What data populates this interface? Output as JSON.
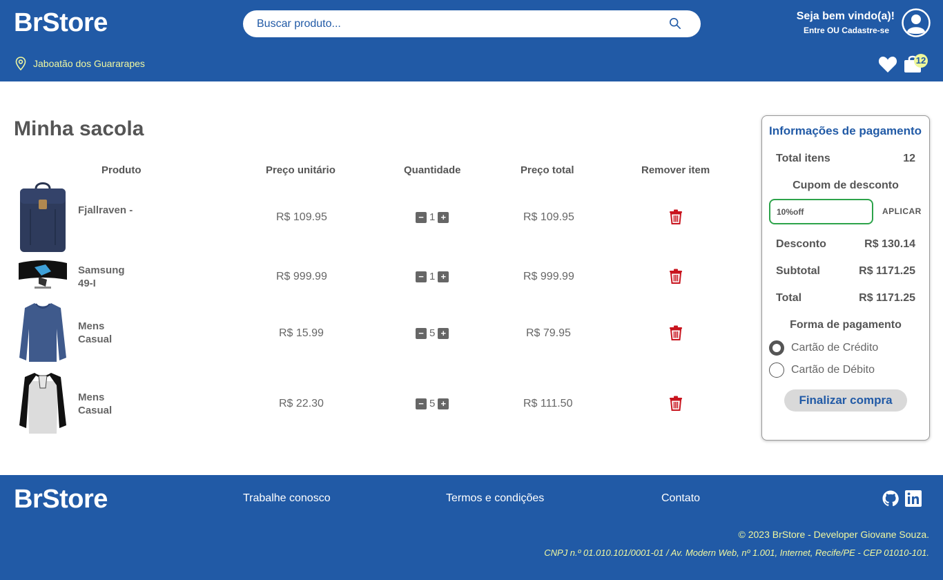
{
  "header": {
    "logo": "BrStore",
    "search_placeholder": "Buscar produto...",
    "welcome": "Seja bem vindo(a)!",
    "login_link": "Entre OU Cadastre-se",
    "location": "Jaboatão dos Guararapes",
    "cart_count": "12"
  },
  "main": {
    "title": "Minha sacola",
    "columns": [
      "Produto",
      "Preço unitário",
      "Quantidade",
      "Preço total",
      "Remover item"
    ],
    "items": [
      {
        "name": "Fjallraven -",
        "unit_price": "R$ 109.95",
        "qty": "1",
        "total": "R$ 109.95",
        "image": "backpack"
      },
      {
        "name": "Samsung 49-I",
        "unit_price": "R$ 999.99",
        "qty": "1",
        "total": "R$ 999.99",
        "image": "monitor"
      },
      {
        "name": "Mens Casual",
        "unit_price": "R$ 15.99",
        "qty": "5",
        "total": "R$ 79.95",
        "image": "blue-shirt"
      },
      {
        "name": "Mens Casual",
        "unit_price": "R$ 22.30",
        "qty": "5",
        "total": "R$ 111.50",
        "image": "raglan-shirt"
      }
    ]
  },
  "payment": {
    "title": "Informações de pagamento",
    "total_items_label": "Total itens",
    "total_items_value": "12",
    "coupon_label": "Cupom de desconto",
    "coupon_value": "10%off",
    "apply_label": "APLICAR",
    "discount_label": "Desconto",
    "discount_value": "R$ 130.14",
    "subtotal_label": "Subtotal",
    "subtotal_value": "R$ 1171.25",
    "total_label": "Total",
    "total_value": "R$ 1171.25",
    "method_label": "Forma de pagamento",
    "methods": [
      "Cartão de Crédito",
      "Cartão de Débito"
    ],
    "selected_method": "Cartão de Crédito",
    "finish_label": "Finalizar compra"
  },
  "footer": {
    "logo": "BrStore",
    "links": [
      "Trabalhe conosco",
      "Termos e condições",
      "Contato"
    ],
    "copyright": "© 2023 BrStore - Developer Giovane Souza.",
    "cnpj": "CNPJ n.º 01.010.101/0001-01 / Av. Modern Web, nº 1.001, Internet, Recife/PE - CEP 01010-101."
  },
  "colors": {
    "brand_blue": "#215aa6",
    "accent_yellow": "#f0f8a0",
    "coupon_green": "#2ca34a",
    "trash_red": "#c8141e"
  }
}
